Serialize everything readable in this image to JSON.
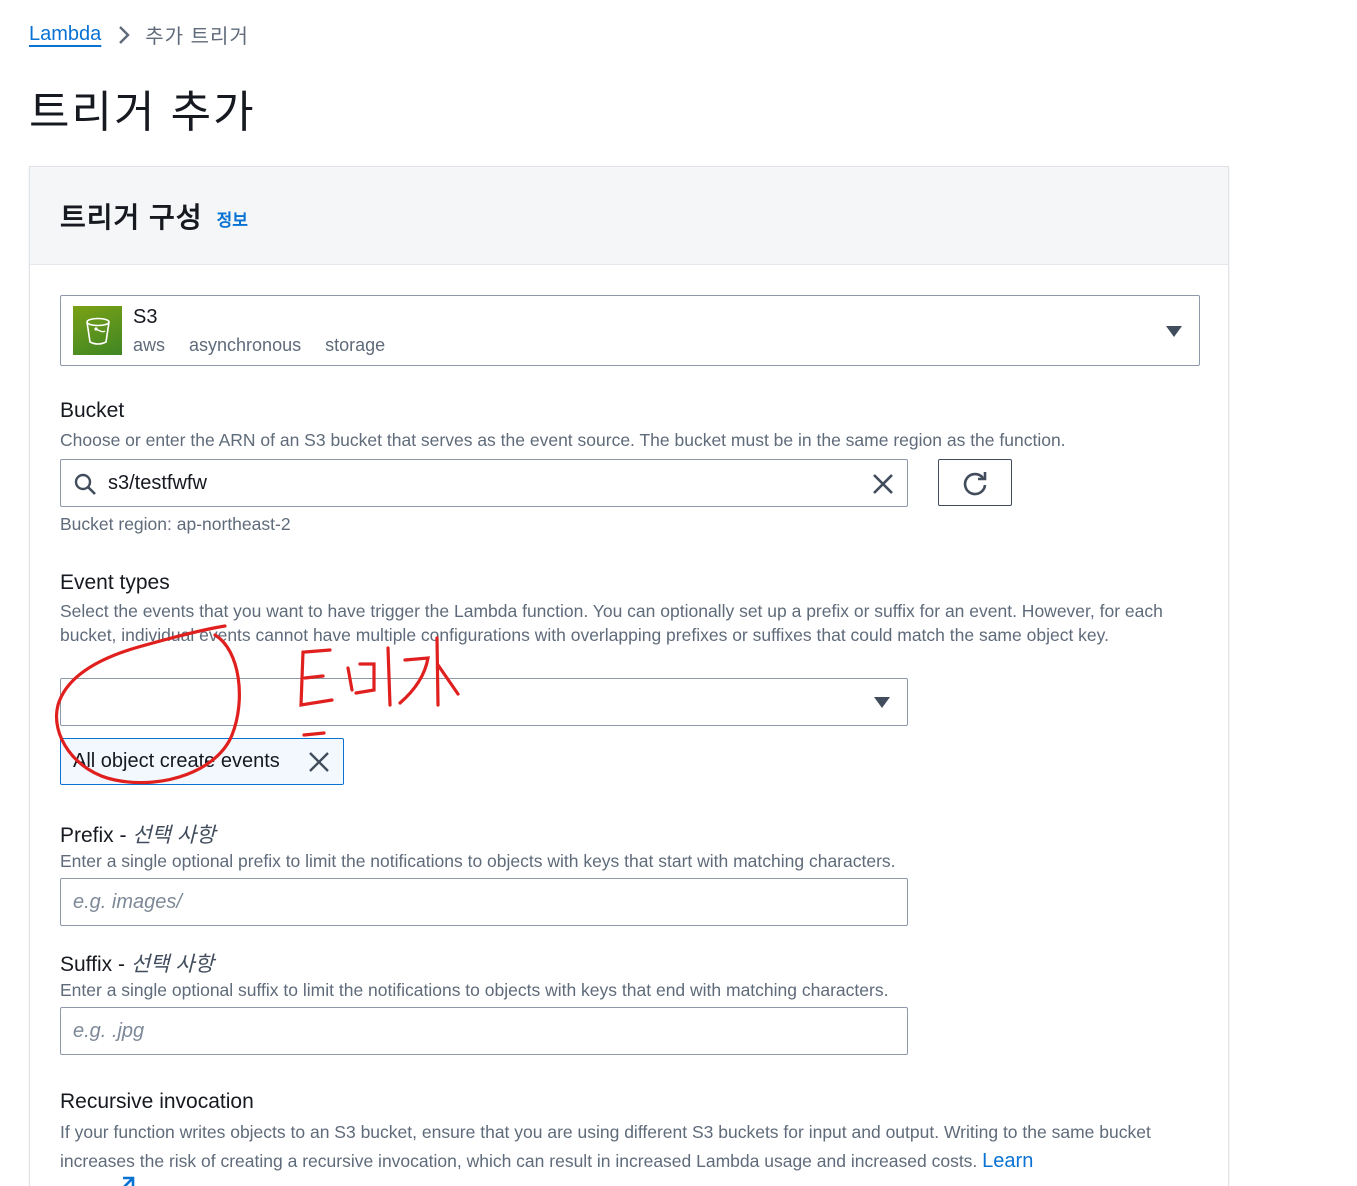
{
  "breadcrumb": {
    "root": "Lambda",
    "current": "추가 트리거"
  },
  "page": {
    "title": "트리거 추가"
  },
  "panel": {
    "title": "트리거 구성",
    "info": "정보"
  },
  "source": {
    "name": "S3",
    "tags": [
      "aws",
      "asynchronous",
      "storage"
    ]
  },
  "bucket": {
    "label": "Bucket",
    "description": "Choose or enter the ARN of an S3 bucket that serves as the event source. The bucket must be in the same region as the function.",
    "value": "s3/testfwfw",
    "region": "Bucket region: ap-northeast-2"
  },
  "event_types": {
    "label": "Event types",
    "description": "Select the events that you want to have trigger the Lambda function. You can optionally set up a prefix or suffix for an event. However, for each bucket, individual events cannot have multiple configurations with overlapping prefixes or suffixes that could match the same object key.",
    "selected_token": "All object create events"
  },
  "prefix": {
    "label": "Prefix - ",
    "optional": "선택 사항",
    "description": "Enter a single optional prefix to limit the notifications to objects with keys that start with matching characters.",
    "placeholder": "e.g. images/"
  },
  "suffix": {
    "label": "Suffix - ",
    "optional": "선택 사항",
    "description": "Enter a single optional suffix to limit the notifications to objects with keys that end with matching characters.",
    "placeholder": "e.g. .jpg"
  },
  "recursive": {
    "label": "Recursive invocation",
    "description": "If your function writes objects to an S3 bucket, ensure that you are using different S3 buckets for input and output. Writing to the same bucket increases the risk of creating a recursive invocation, which can result in increased Lambda usage and increased costs.",
    "learn_link": "Learn"
  },
  "colors": {
    "link": "#0972d3",
    "border": "#8d99a8",
    "s3_green": "#3f8624",
    "annotation": "#e0201e"
  }
}
